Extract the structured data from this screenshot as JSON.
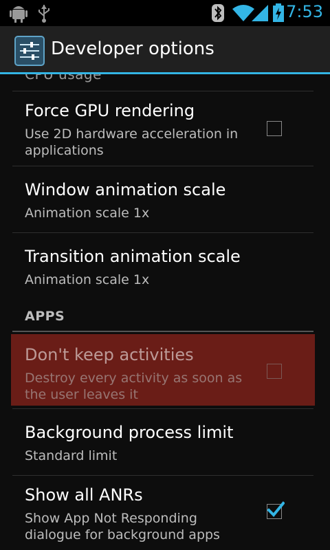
{
  "status_bar": {
    "time": "7:53",
    "icons_left": [
      "android-debug-icon",
      "usb-icon"
    ],
    "icons_right": [
      "bluetooth-icon",
      "wifi-icon",
      "signal-icon",
      "battery-charging-icon"
    ]
  },
  "action_bar": {
    "title": "Developer options",
    "icon": "developer-settings-icon"
  },
  "list": {
    "cut_label": "CPU usage",
    "items": [
      {
        "title": "Force GPU rendering",
        "summary": "Use 2D hardware acceleration in applications",
        "checked": false
      },
      {
        "title": "Window animation scale",
        "summary": "Animation scale 1x"
      },
      {
        "title": "Transition animation scale",
        "summary": "Animation scale 1x"
      }
    ],
    "section_apps": "APPS",
    "apps_items": [
      {
        "title": "Don't keep activities",
        "summary": "Destroy every activity as soon as the user leaves it",
        "checked": false,
        "highlighted": true
      },
      {
        "title": "Background process limit",
        "summary": "Standard limit"
      },
      {
        "title": "Show all ANRs",
        "summary": "Show App Not Responding dialogue for background apps",
        "checked": true
      }
    ]
  },
  "colors": {
    "accent": "#33b5e5",
    "highlight": "#6a1d17"
  }
}
